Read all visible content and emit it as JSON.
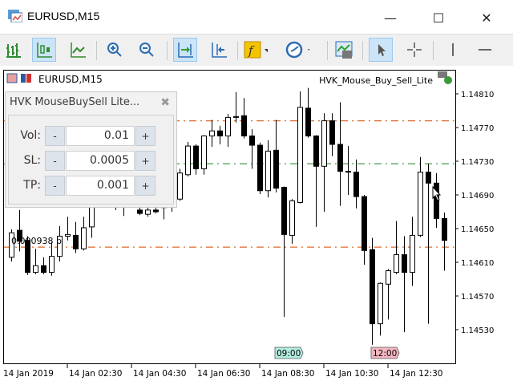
{
  "window": {
    "title": "EURUSD,M15",
    "minimize": "—",
    "maximize": "☐",
    "close": "✕"
  },
  "toolbar": {
    "items": [
      "bar-chart",
      "candlesticks",
      "line-chart",
      "zoom-in",
      "zoom-out",
      "auto-scroll",
      "chart-shift",
      "indicators",
      "periods",
      "templates",
      "cursor",
      "crosshair",
      "vertical-line",
      "horizontal-line"
    ]
  },
  "chart": {
    "symbol_label": "EURUSD,M15",
    "ea_name": "HVK_Mouse_Buy_Sell_Lite",
    "info_text": "0.000938 p",
    "price_ticks": [
      "1.14810",
      "1.14770",
      "1.14730",
      "1.14690",
      "1.14650",
      "1.14610",
      "1.14570",
      "1.14530"
    ],
    "time_labels": [
      "14 Jan 2019",
      "14 Jan 02:30",
      "14 Jan 04:30",
      "14 Jan 06:30",
      "14 Jan 08:30",
      "14 Jan 10:30",
      "14 Jan 12:30"
    ],
    "time_flags": [
      {
        "label": "09:00",
        "color": "#b3ece0"
      },
      {
        "label": "12:00",
        "color": "#f4b6c0"
      }
    ],
    "levels": [
      {
        "price": 1.14778,
        "color": "#e06a2c",
        "kind": "take-profit"
      },
      {
        "price": 1.14727,
        "color": "#4a9a4a",
        "kind": "entry"
      },
      {
        "price": 1.14628,
        "color": "#e06a2c",
        "kind": "stop-loss"
      }
    ]
  },
  "panel": {
    "title": "HVK MouseBuySell Lite...",
    "close": "✖",
    "rows": [
      {
        "label": "Vol:",
        "value": "0.01",
        "minus": "-",
        "plus": "+"
      },
      {
        "label": "SL:",
        "value": "0.0005",
        "minus": "-",
        "plus": "+"
      },
      {
        "label": "TP:",
        "value": "0.001",
        "minus": "-",
        "plus": "+"
      }
    ]
  },
  "chart_data": {
    "type": "candlestick",
    "symbol": "EURUSD",
    "timeframe": "M15",
    "ylim": [
      1.145,
      1.1484
    ],
    "candles_ohlc": [
      [
        1.14616,
        1.14649,
        1.14611,
        1.14645
      ],
      [
        1.14648,
        1.14672,
        1.14623,
        1.14635
      ],
      [
        1.14636,
        1.14641,
        1.14595,
        1.14598
      ],
      [
        1.14598,
        1.14626,
        1.14596,
        1.14606
      ],
      [
        1.14606,
        1.14616,
        1.14596,
        1.14598
      ],
      [
        1.14598,
        1.14634,
        1.14594,
        1.14617
      ],
      [
        1.14617,
        1.14653,
        1.14611,
        1.14641
      ],
      [
        1.14641,
        1.14664,
        1.14636,
        1.14643
      ],
      [
        1.14642,
        1.14658,
        1.14621,
        1.14626
      ],
      [
        1.14626,
        1.14664,
        1.14624,
        1.14651
      ],
      [
        1.14652,
        1.14693,
        1.14639,
        1.14683
      ],
      [
        1.14683,
        1.147,
        1.14675,
        1.14695
      ],
      [
        1.14695,
        1.14712,
        1.14688,
        1.1469
      ],
      [
        1.1469,
        1.14705,
        1.14672,
        1.14678
      ],
      [
        1.14678,
        1.14692,
        1.14665,
        1.14688
      ],
      [
        1.14688,
        1.14702,
        1.1468,
        1.14697
      ],
      [
        1.14672,
        1.1469,
        1.14666,
        1.14668
      ],
      [
        1.14667,
        1.14685,
        1.14664,
        1.14672
      ],
      [
        1.14672,
        1.14688,
        1.14668,
        1.1467
      ],
      [
        1.14675,
        1.1469,
        1.14661,
        1.14676
      ],
      [
        1.14676,
        1.14705,
        1.1467,
        1.147
      ],
      [
        1.14685,
        1.14721,
        1.14683,
        1.14716
      ],
      [
        1.14714,
        1.14753,
        1.14712,
        1.14748
      ],
      [
        1.14748,
        1.1475,
        1.14714,
        1.14721
      ],
      [
        1.14721,
        1.14761,
        1.14714,
        1.1476
      ],
      [
        1.1476,
        1.14779,
        1.14747,
        1.14766
      ],
      [
        1.14766,
        1.14772,
        1.1475,
        1.1476
      ],
      [
        1.1476,
        1.14786,
        1.14747,
        1.14782
      ],
      [
        1.14782,
        1.14812,
        1.14776,
        1.14783
      ],
      [
        1.14784,
        1.14805,
        1.14757,
        1.1476
      ],
      [
        1.1476,
        1.14768,
        1.14721,
        1.14749
      ],
      [
        1.14749,
        1.14752,
        1.14691,
        1.14695
      ],
      [
        1.14695,
        1.14755,
        1.14687,
        1.14742
      ],
      [
        1.14743,
        1.14779,
        1.14693,
        1.14698
      ],
      [
        1.14699,
        1.147,
        1.14545,
        1.14643
      ],
      [
        1.14642,
        1.14685,
        1.14632,
        1.14683
      ],
      [
        1.14681,
        1.14813,
        1.1468,
        1.14794
      ],
      [
        1.14793,
        1.14817,
        1.14758,
        1.1476
      ],
      [
        1.1476,
        1.14761,
        1.14652,
        1.14724
      ],
      [
        1.14724,
        1.14787,
        1.1467,
        1.14778
      ],
      [
        1.14778,
        1.14787,
        1.14736,
        1.1475
      ],
      [
        1.1475,
        1.148,
        1.14677,
        1.14718
      ],
      [
        1.14718,
        1.14748,
        1.1469,
        1.14717
      ],
      [
        1.14717,
        1.14732,
        1.14674,
        1.14688
      ],
      [
        1.14688,
        1.1469,
        1.14607,
        1.14624
      ],
      [
        1.14625,
        1.14639,
        1.14512,
        1.14537
      ],
      [
        1.14537,
        1.14586,
        1.14523,
        1.14585
      ],
      [
        1.14584,
        1.14602,
        1.14542,
        1.146
      ],
      [
        1.14598,
        1.14659,
        1.14596,
        1.14619
      ],
      [
        1.14619,
        1.14641,
        1.14527,
        1.14598
      ],
      [
        1.14598,
        1.14664,
        1.14582,
        1.14642
      ],
      [
        1.14642,
        1.14735,
        1.1464,
        1.14717
      ],
      [
        1.14717,
        1.14727,
        1.14537,
        1.14704
      ],
      [
        1.14704,
        1.14716,
        1.14651,
        1.14662
      ],
      [
        1.14662,
        1.14669,
        1.146,
        1.14636
      ]
    ]
  }
}
